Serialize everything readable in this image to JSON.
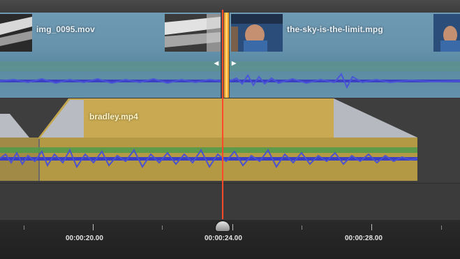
{
  "timeline": {
    "track1": {
      "clips": [
        {
          "name": "img_0095.mov"
        },
        {
          "name": "the-sky-is-the-limit.mpg"
        }
      ]
    },
    "track2": {
      "clips": [
        {
          "name": "bradley.mp4"
        }
      ]
    },
    "ruler": {
      "timecodes": [
        "00:00:20.00",
        "00:00:24.00",
        "00:00:28.00"
      ]
    }
  },
  "colors": {
    "video_clip": "#6893ad",
    "audio_clip": "#c4a64e",
    "waveform": "#3a3fc4",
    "playhead": "#ff4a2a",
    "trim_marker": "#f2a12b"
  },
  "icons": {
    "trim_left": "trim-left-arrow-icon",
    "trim_right": "trim-right-arrow-icon",
    "playhead_handle": "playhead-handle-icon"
  }
}
